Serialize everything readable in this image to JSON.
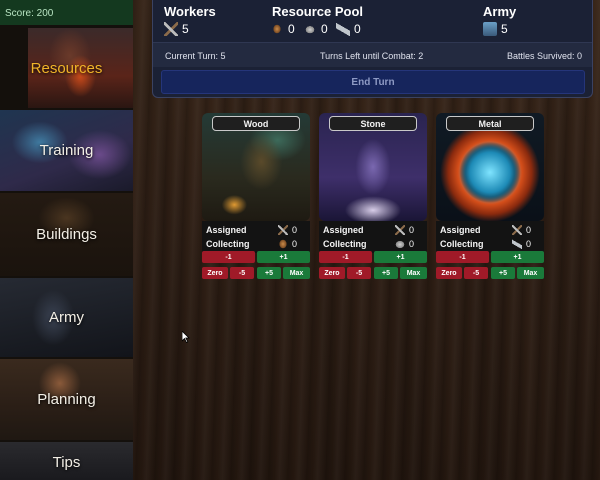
{
  "score": "Score: 200",
  "nav": {
    "resources": "Resources",
    "training": "Training",
    "buildings": "Buildings",
    "army": "Army",
    "planning": "Planning",
    "tips": "Tips"
  },
  "header": {
    "workers_label": "Workers",
    "workers_value": "5",
    "pool_label": "Resource Pool",
    "pool_wood": "0",
    "pool_stone": "0",
    "pool_metal": "0",
    "army_label": "Army",
    "army_value": "5"
  },
  "turn": {
    "current": "Current Turn: 5",
    "left": "Turns Left until Combat: 2",
    "battles": "Battles Survived: 0"
  },
  "end_turn_label": "End Turn",
  "cards": [
    {
      "title": "Wood",
      "assigned_label": "Assigned",
      "assigned": "0",
      "collecting_label": "Collecting",
      "collecting": "0"
    },
    {
      "title": "Stone",
      "assigned_label": "Assigned",
      "assigned": "0",
      "collecting_label": "Collecting",
      "collecting": "0"
    },
    {
      "title": "Metal",
      "assigned_label": "Assigned",
      "assigned": "0",
      "collecting_label": "Collecting",
      "collecting": "0"
    }
  ],
  "buttons": {
    "minus1": "-1",
    "plus1": "+1",
    "zero": "Zero",
    "minus5": "-5",
    "plus5": "+5",
    "max": "Max"
  },
  "icons": {
    "workers": "tools-icon",
    "wood": "wood-icon",
    "stone": "stone-icon",
    "metal": "metal-icon",
    "army": "army-icon"
  }
}
